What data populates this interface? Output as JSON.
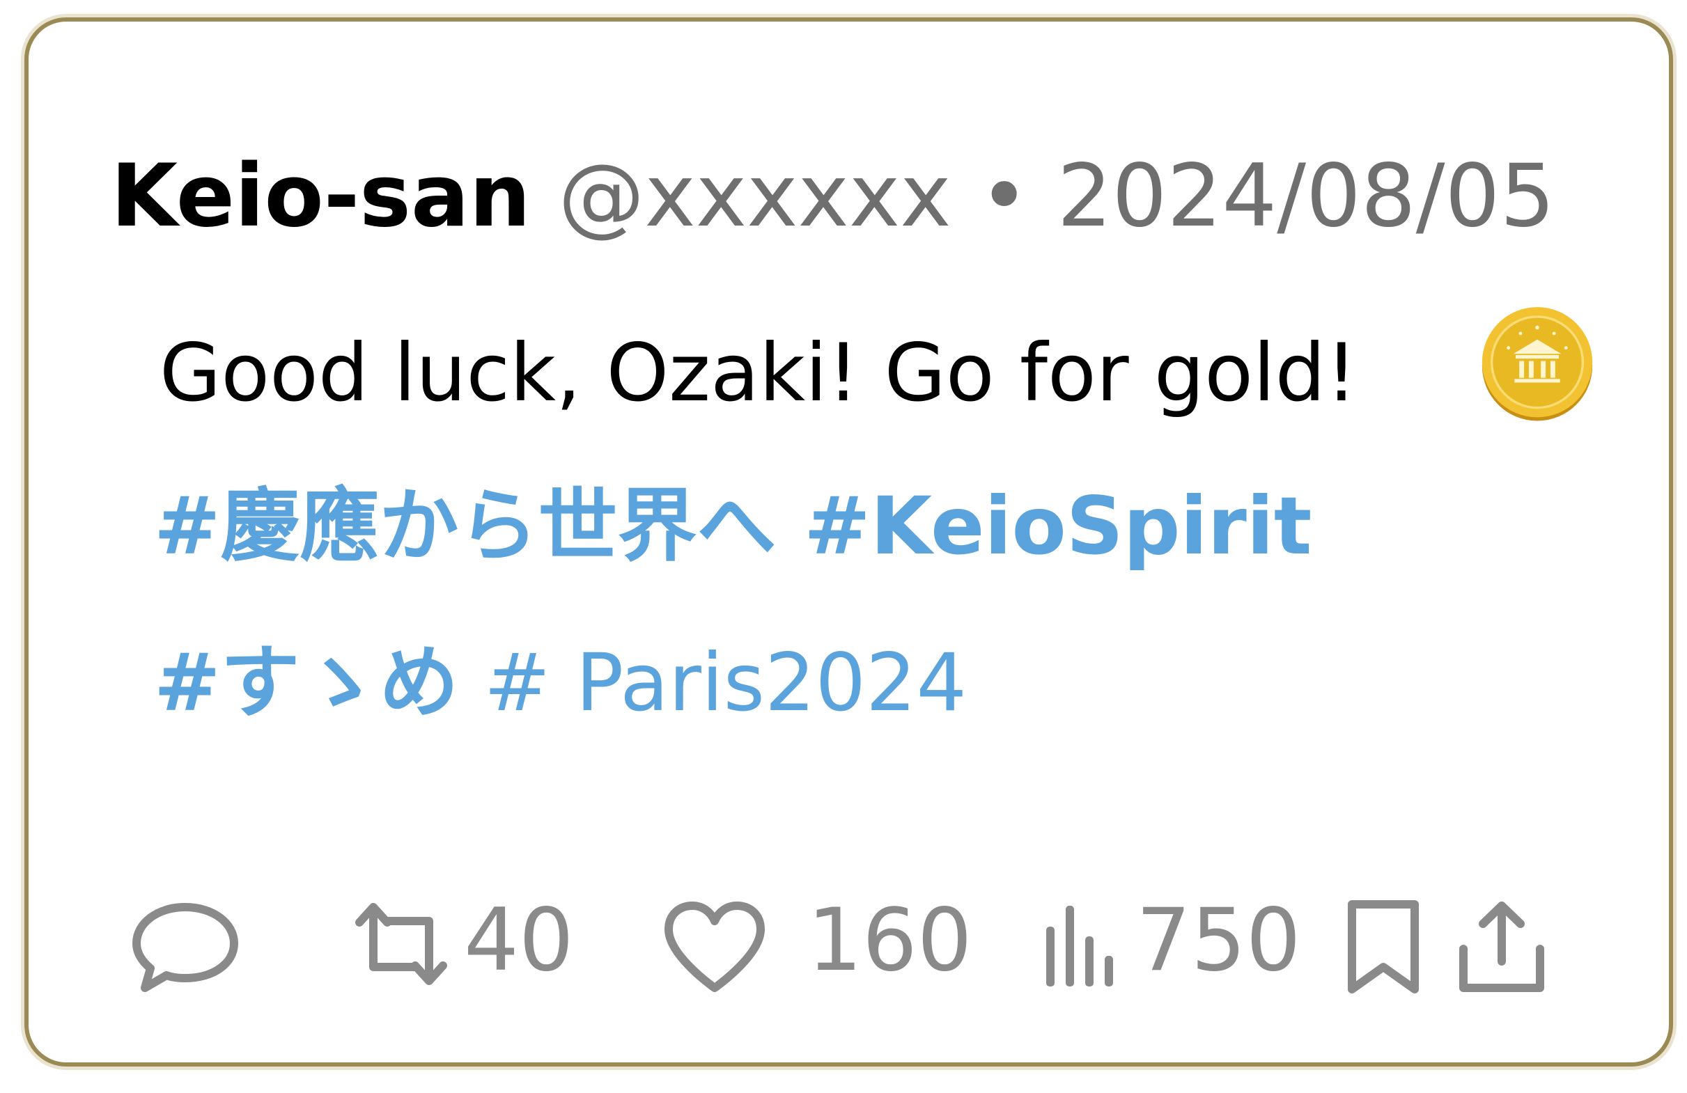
{
  "tweet": {
    "display_name": "Keio-san",
    "handle": "@xxxxxx",
    "separator": "•",
    "date": "2024/08/05",
    "text": "Good luck, Ozaki!  Go for gold!",
    "emoji_icon": "gold-coin-icon",
    "hashtags_line1": [
      "#慶應から世界へ",
      "#KeioSpirit"
    ],
    "hashtags_line2": [
      "#すゝめ",
      "# Paris2024"
    ]
  },
  "actions": {
    "reply": {
      "icon": "reply-icon"
    },
    "retweet": {
      "icon": "retweet-icon",
      "count": "40"
    },
    "like": {
      "icon": "heart-icon",
      "count": "160"
    },
    "views": {
      "icon": "views-icon",
      "count": "750"
    },
    "bookmark": {
      "icon": "bookmark-icon"
    },
    "share": {
      "icon": "share-icon"
    }
  },
  "colors": {
    "hashtag": "#5aa3dc",
    "border": "#9c8a55",
    "muted": "#6f6f6f",
    "icon_gray": "#8a8a8a",
    "coin_gold": "#e8b923"
  }
}
